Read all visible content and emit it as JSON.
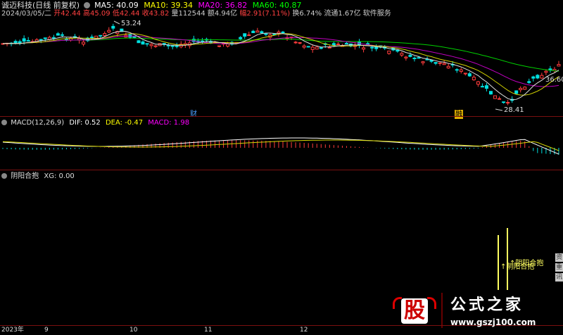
{
  "header": {
    "stock_name": "诚迈科技(日线 前复权)",
    "ma5_label": "MA5: 40.09",
    "ma10_label": "MA10: 39.34",
    "ma20_label": "MA20: 36.82",
    "ma60_label": "MA60: 40.87",
    "date": "2024/03/05/二",
    "open": "开42.44",
    "high": "高45.09",
    "low": "低42.44",
    "close": "收43.82",
    "volume": "量112544",
    "amount": "额4.94亿",
    "change": "幅2.91(7.11%)",
    "turnover": "换6.74%",
    "float_cap": "流通1.67亿",
    "industry": "软件服务"
  },
  "price_chart": {
    "high_label": "53.24",
    "low_label": "28.41",
    "right_label": "36.60",
    "event_marker_1": "财",
    "event_marker_2": "融"
  },
  "macd_panel": {
    "title": "MACD(12,26,9)",
    "dif": "DIF: 0.52",
    "dea": "DEA: -0.47",
    "macd": "MACD: 1.98"
  },
  "indicator_panel": {
    "title": "阴阳合抱",
    "xg": "XG: 0.00",
    "signal_label_1": "阴阳合抱",
    "signal_label_2": "阴阳合抱"
  },
  "x_axis": {
    "labels": [
      "2023年",
      "9",
      "10",
      "11",
      "12"
    ]
  },
  "right_tabs": [
    "资",
    "重",
    "讯"
  ],
  "watermark": {
    "logo_char": "股",
    "brand": "公式之家",
    "url": "www.gszj100.com"
  },
  "colors": {
    "ma5": "#ffffff",
    "ma10": "#ffff00",
    "ma20": "#ff00ff",
    "ma60": "#00ff00",
    "up": "#ff3c3c",
    "down": "#00ffff",
    "separator": "#7a1010"
  }
}
